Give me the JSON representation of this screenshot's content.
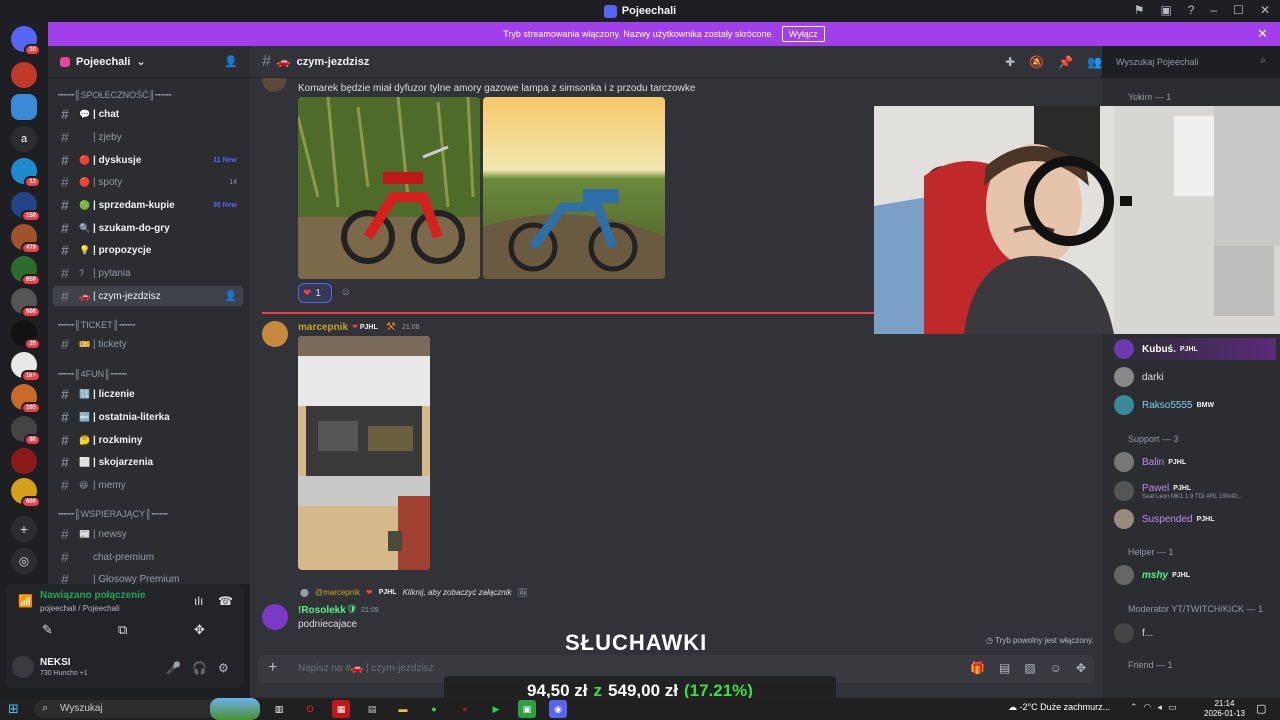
{
  "window": {
    "title": "Pojeechali"
  },
  "banner": {
    "text": "Tryb streamowania włączony. Nazwy użytkownika zostały skrócone.",
    "button": "Wyłącz"
  },
  "guilds": {
    "badges": [
      "20",
      "12",
      "158",
      "479",
      "859",
      "608",
      "20",
      "1k+",
      "205",
      "86",
      "609"
    ],
    "letter": "a"
  },
  "server": {
    "name": "Pojeechali"
  },
  "categories": {
    "spolecznosc": "╍╍╍║SPOŁECZNOŚĆ║╍╍╍",
    "ticket": "╍╍╍║TICKET║╍╍╍",
    "fun": "╍╍╍║4FUN║╍╍╍",
    "wspierajacy": "╍╍╍║WSPIERAJĄCY║╍╍╍"
  },
  "channels": [
    {
      "name": "| chat",
      "emoji": "💬"
    },
    {
      "name": "| zjeby",
      "emoji": ""
    },
    {
      "name": "| dyskusje",
      "emoji": "🔴",
      "badge": "11 New"
    },
    {
      "name": "| spoty",
      "emoji": "🔴",
      "count": "14"
    },
    {
      "name": "| sprzedam-kupie",
      "emoji": "🟢",
      "badge": "30 New"
    },
    {
      "name": "| szukam-do-gry",
      "emoji": "🔍"
    },
    {
      "name": "| propozycje",
      "emoji": "💡"
    },
    {
      "name": "| pytania",
      "emoji": "?"
    },
    {
      "name": "| czym-jezdzisz",
      "emoji": "🚗"
    },
    {
      "name": "| tickety",
      "emoji": "🎫"
    },
    {
      "name": "| liczenie",
      "emoji": "🔢"
    },
    {
      "name": "| ostatnia-literka",
      "emoji": "🔤"
    },
    {
      "name": "| rozkminy",
      "emoji": "🤔"
    },
    {
      "name": "| skojarzenia",
      "emoji": "⬜"
    },
    {
      "name": "| memy",
      "emoji": "😆"
    },
    {
      "name": "| newsy",
      "emoji": "📰"
    },
    {
      "name": "chat-premium",
      "emoji": ""
    },
    {
      "name": "| Głosowy Premium",
      "emoji": ""
    }
  ],
  "voice": {
    "status": "Nawiązano połączenie",
    "location": "pojeechali / Pojeechali"
  },
  "user": {
    "name": "NEKSI",
    "status": "730 Huncho +1"
  },
  "channel_header": {
    "name": "czym-jezdzisz"
  },
  "search": {
    "placeholder": "Wyszukaj Pojeechali"
  },
  "messages": {
    "first_text": "Komarek będzie miał dyfuzor tylne amory gazowe lampa z simsonka i z przodu tarczowke",
    "reaction_count": "1",
    "second_user": "marcepnik",
    "second_tag": "PJHL",
    "second_time": "21:08",
    "reply_user": "@marcepnik",
    "reply_tag": "PJHL",
    "reply_text": "Kliknij, aby zobaczyć załącznik",
    "third_user": "!Rosolekk",
    "third_time": "21:09",
    "third_text": "podniecajace"
  },
  "slowmode": "Tryb powolny jest włączony.",
  "composer": {
    "placeholder": "Napisz na #🚗 | czym-jezdzisz"
  },
  "members": {
    "groups": [
      {
        "label": "Yokim — 1"
      },
      {
        "label": "Support — 3"
      },
      {
        "label": "Helper — 1"
      },
      {
        "label": "Moderator YT/TWITCH/KICK — 1"
      },
      {
        "label": "Friend — 1"
      }
    ],
    "list": [
      {
        "name": "Kubuś.",
        "tag": "PJHL",
        "color": "#ffffff"
      },
      {
        "name": "darki",
        "tag": "",
        "color": "#dbdee1"
      },
      {
        "name": "Rakso5555",
        "tag": "BMW",
        "color": "#7fd1e8"
      },
      {
        "name": "Balin",
        "tag": "PJHL",
        "color": "#c08cf0"
      },
      {
        "name": "Pawel",
        "tag": "PJHL",
        "color": "#c08cf0",
        "status": "Seat Leon MK1 1.9 TDI ARL 190/42..."
      },
      {
        "name": "Suspended",
        "tag": "PJHL",
        "color": "#c08cf0"
      },
      {
        "name": "mshy",
        "tag": "PJHL",
        "color": "#57f287"
      },
      {
        "name": "f...",
        "tag": "",
        "color": "#dbdee1"
      }
    ]
  },
  "overlay": {
    "caption": "SŁUCHAWKI",
    "amount": "94,50 zł",
    "of": "z",
    "goal": "549,00 zł",
    "percent": "(17.21%)"
  },
  "taskbar": {
    "search": "Wyszukaj",
    "weather": "-2°C  Duże zachmurz...",
    "time": "21:14",
    "date": "2026-01-13"
  }
}
